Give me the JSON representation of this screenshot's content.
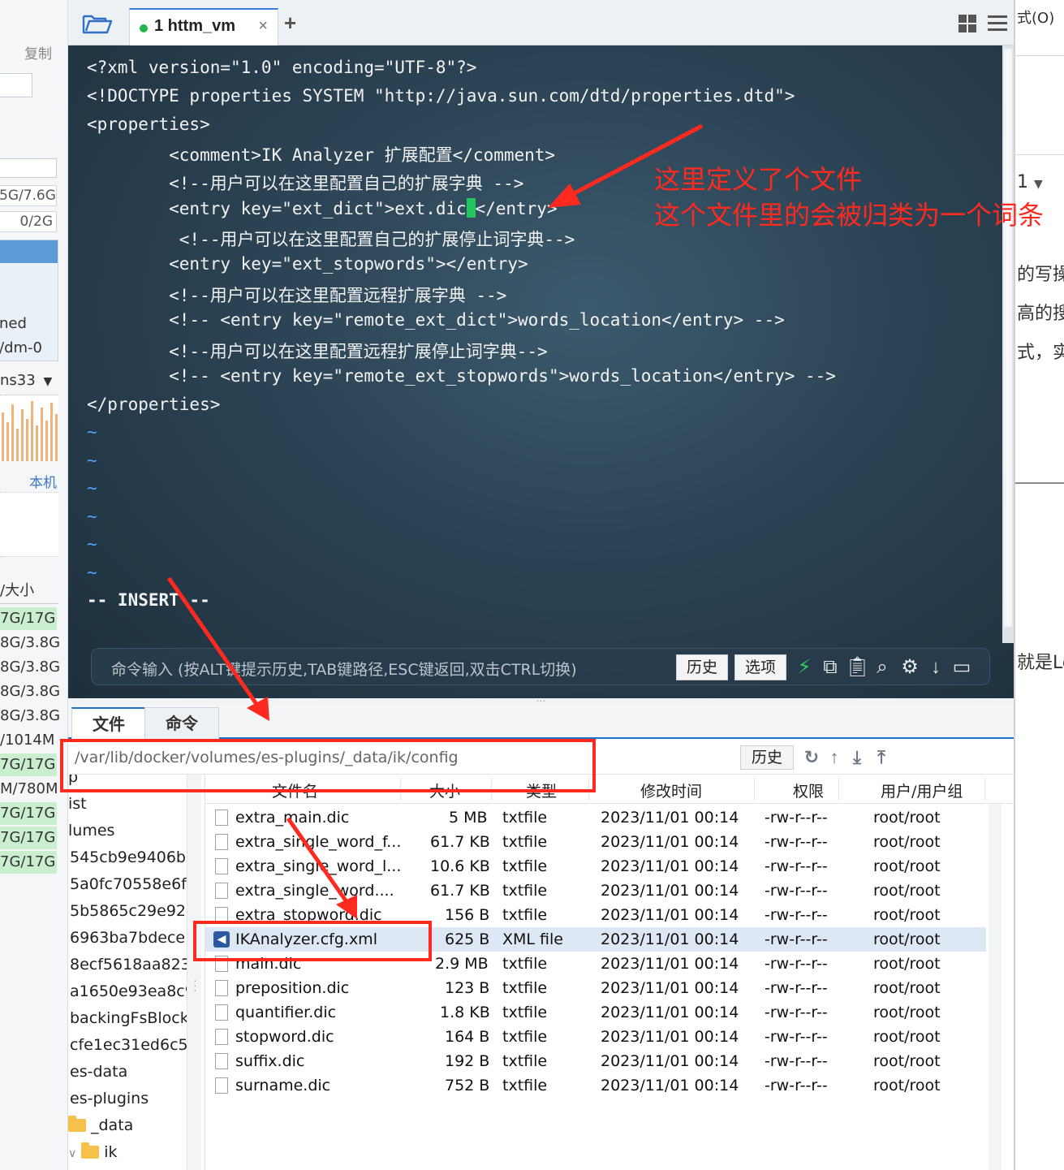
{
  "left_strip": {
    "copy_label": "复制",
    "stat1": "5G/7.6G",
    "stat2": "0/2G",
    "panel_row1": "ned",
    "panel_row2": "/dm-0",
    "host_label": "ns33",
    "local_label": "本机",
    "size_header": "/大小",
    "sizes": [
      "7G/17G",
      "8G/3.8G",
      "8G/3.8G",
      "8G/3.8G",
      "8G/3.8G",
      "/1014M",
      "7G/17G",
      "M/780M",
      "7G/17G",
      "7G/17G",
      "7G/17G"
    ]
  },
  "right_strip": {
    "menu_label": "式(O)",
    "num_label": "1",
    "text1": "的写操",
    "text2": "高的搜",
    "text3": "式，实",
    "text4": "就是Lo"
  },
  "tabbar": {
    "tab_title": "1 httm_vm",
    "close_glyph": "×",
    "add_glyph": "+"
  },
  "terminal": {
    "lines": [
      "<?xml version=\"1.0\" encoding=\"UTF-8\"?>",
      "<!DOCTYPE properties SYSTEM \"http://java.sun.com/dtd/properties.dtd\">",
      "<properties>",
      "        <comment>IK Analyzer 扩展配置</comment>",
      "        <!--用户可以在这里配置自己的扩展字典 -->",
      "        <entry key=\"ext_dict\">ext.dic",
      " </entry>",
      "         <!--用户可以在这里配置自己的扩展停止词字典-->",
      "        <entry key=\"ext_stopwords\"></entry>",
      "        <!--用户可以在这里配置远程扩展字典 -->",
      "        <!-- <entry key=\"remote_ext_dict\">words_location</entry> -->",
      "        <!--用户可以在这里配置远程扩展停止词字典-->",
      "        <!-- <entry key=\"remote_ext_stopwords\">words_location</entry> -->",
      "</properties>"
    ],
    "tilde": "~",
    "mode_line": "-- INSERT --"
  },
  "cmdbar": {
    "placeholder": "命令输入 (按ALT键提示历史,TAB键路径,ESC键返回,双击CTRL切换)",
    "history_label": "历史",
    "options_label": "选项"
  },
  "bottom_tabs": {
    "files_label": "文件",
    "commands_label": "命令"
  },
  "pathbar": {
    "path": "/var/lib/docker/volumes/es-plugins/_data/ik/config",
    "history_label": "历史"
  },
  "tree": {
    "items": [
      "p",
      "ist",
      "lumes",
      "545cb9e9406b",
      "5a0fc70558e6f",
      "5b5865c29e92",
      "6963ba7bdece",
      "8ecf5618aa823",
      "a1650e93ea8c9",
      "backingFsBlock",
      "cfe1ec31ed6c5",
      "es-data",
      "es-plugins",
      "_data",
      "ik"
    ]
  },
  "filelist": {
    "headers": {
      "name": "文件名",
      "size": "大小",
      "type": "类型",
      "mtime": "修改时间",
      "perm": "权限",
      "owner": "用户/用户组"
    },
    "rows": [
      {
        "name": "extra_main.dic",
        "size": "5 MB",
        "type": "txtfile",
        "mtime": "2023/11/01 00:14",
        "perm": "-rw-r--r--",
        "owner": "root/root"
      },
      {
        "name": "extra_single_word_f...",
        "size": "61.7 KB",
        "type": "txtfile",
        "mtime": "2023/11/01 00:14",
        "perm": "-rw-r--r--",
        "owner": "root/root"
      },
      {
        "name": "extra_single_word_l...",
        "size": "10.6 KB",
        "type": "txtfile",
        "mtime": "2023/11/01 00:14",
        "perm": "-rw-r--r--",
        "owner": "root/root"
      },
      {
        "name": "extra_single_word....",
        "size": "61.7 KB",
        "type": "txtfile",
        "mtime": "2023/11/01 00:14",
        "perm": "-rw-r--r--",
        "owner": "root/root"
      },
      {
        "name": "extra_stopword.dic",
        "size": "156 B",
        "type": "txtfile",
        "mtime": "2023/11/01 00:14",
        "perm": "-rw-r--r--",
        "owner": "root/root"
      },
      {
        "name": "IKAnalyzer.cfg.xml",
        "size": "625 B",
        "type": "XML file",
        "mtime": "2023/11/01 00:14",
        "perm": "-rw-r--r--",
        "owner": "root/root"
      },
      {
        "name": "main.dic",
        "size": "2.9 MB",
        "type": "txtfile",
        "mtime": "2023/11/01 00:14",
        "perm": "-rw-r--r--",
        "owner": "root/root"
      },
      {
        "name": "preposition.dic",
        "size": "123 B",
        "type": "txtfile",
        "mtime": "2023/11/01 00:14",
        "perm": "-rw-r--r--",
        "owner": "root/root"
      },
      {
        "name": "quantifier.dic",
        "size": "1.8 KB",
        "type": "txtfile",
        "mtime": "2023/11/01 00:14",
        "perm": "-rw-r--r--",
        "owner": "root/root"
      },
      {
        "name": "stopword.dic",
        "size": "164 B",
        "type": "txtfile",
        "mtime": "2023/11/01 00:14",
        "perm": "-rw-r--r--",
        "owner": "root/root"
      },
      {
        "name": "suffix.dic",
        "size": "192 B",
        "type": "txtfile",
        "mtime": "2023/11/01 00:14",
        "perm": "-rw-r--r--",
        "owner": "root/root"
      },
      {
        "name": "surname.dic",
        "size": "752 B",
        "type": "txtfile",
        "mtime": "2023/11/01 00:14",
        "perm": "-rw-r--r--",
        "owner": "root/root"
      }
    ]
  },
  "annotation": {
    "line1": "这里定义了个文件",
    "line2": "这个文件里的会被归类为一个词条",
    "color": "#ff2a1f"
  },
  "colors": {
    "accent": "#1e72c8",
    "selection": "#dde8f4",
    "cursor": "#22c55e",
    "tab_dot": "#22b34c"
  }
}
